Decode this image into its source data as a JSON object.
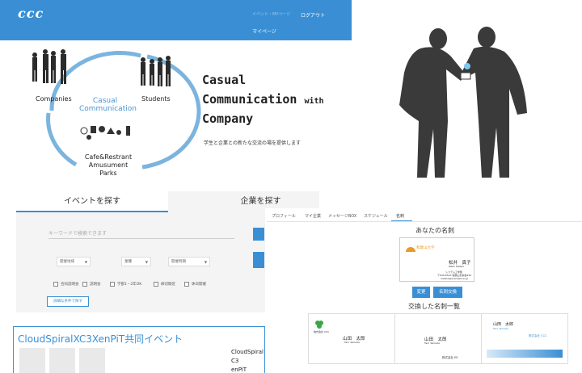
{
  "header": {
    "logo": "ccc",
    "nav_faded": "イベント・MYページ",
    "logout": "ログアウト",
    "mypage": "マイページ"
  },
  "hero": {
    "companies": "Companies",
    "students": "Students",
    "center": [
      "Casual",
      "Communication"
    ],
    "bottom": [
      "Cafe&Restrant",
      "Amusument Parks"
    ],
    "tagline1": "Casual",
    "tagline2_main": "Communication",
    "tagline2_small": "with",
    "tagline3": "Company",
    "subline": "学生と企業との新たな交流の場を提供します"
  },
  "search": {
    "tab_event": "イベントを探す",
    "tab_company": "企業を探す",
    "keyword_placeholder": "キーワードで検索できます",
    "selects": [
      "開催地域",
      "業種",
      "開催時期"
    ],
    "checkboxes": [
      "合同説明会",
      "説明会",
      "学部1・2年OK",
      "締切間近",
      "休日開催"
    ],
    "detail_button": "詳細な条件で探す"
  },
  "event": {
    "title": "CloudSpiralXC3XenPiT共同イベント",
    "side": [
      "CloudSpiral",
      "C3",
      "enPiT"
    ]
  },
  "card_manager": {
    "tabs": [
      "プロフィール",
      "マイ企業",
      "メッセージBOX",
      "スケジュール",
      "名刺"
    ],
    "your_card_heading": "あなたの名刺",
    "my_card": {
      "org": "和歌山大学",
      "kana": "Mami Matsui",
      "name": "松井　真子",
      "lines": [
        "システム工学部",
        "〒640-8510 和歌山市栄谷930",
        "matsui@example.ac.jp"
      ]
    },
    "edit_button": "変更",
    "exchange_button": "名刺交換",
    "exchanged_heading": "交換した名刺一覧",
    "cards": [
      {
        "company": "株式会社 CCC",
        "name": "山田　太郎",
        "kana": "Taro Yamada"
      },
      {
        "company": "株式会社 EE",
        "name": "山田　太郎",
        "kana": "Taro Yamada"
      },
      {
        "company": "株式会社 CCC",
        "name": "山田　太郎",
        "kana": "Taro Yamada"
      }
    ]
  },
  "colors": {
    "brand_blue": "#3a8fd4",
    "panel_gray": "#f4f4f4",
    "silhouette": "#3a3a3a"
  }
}
